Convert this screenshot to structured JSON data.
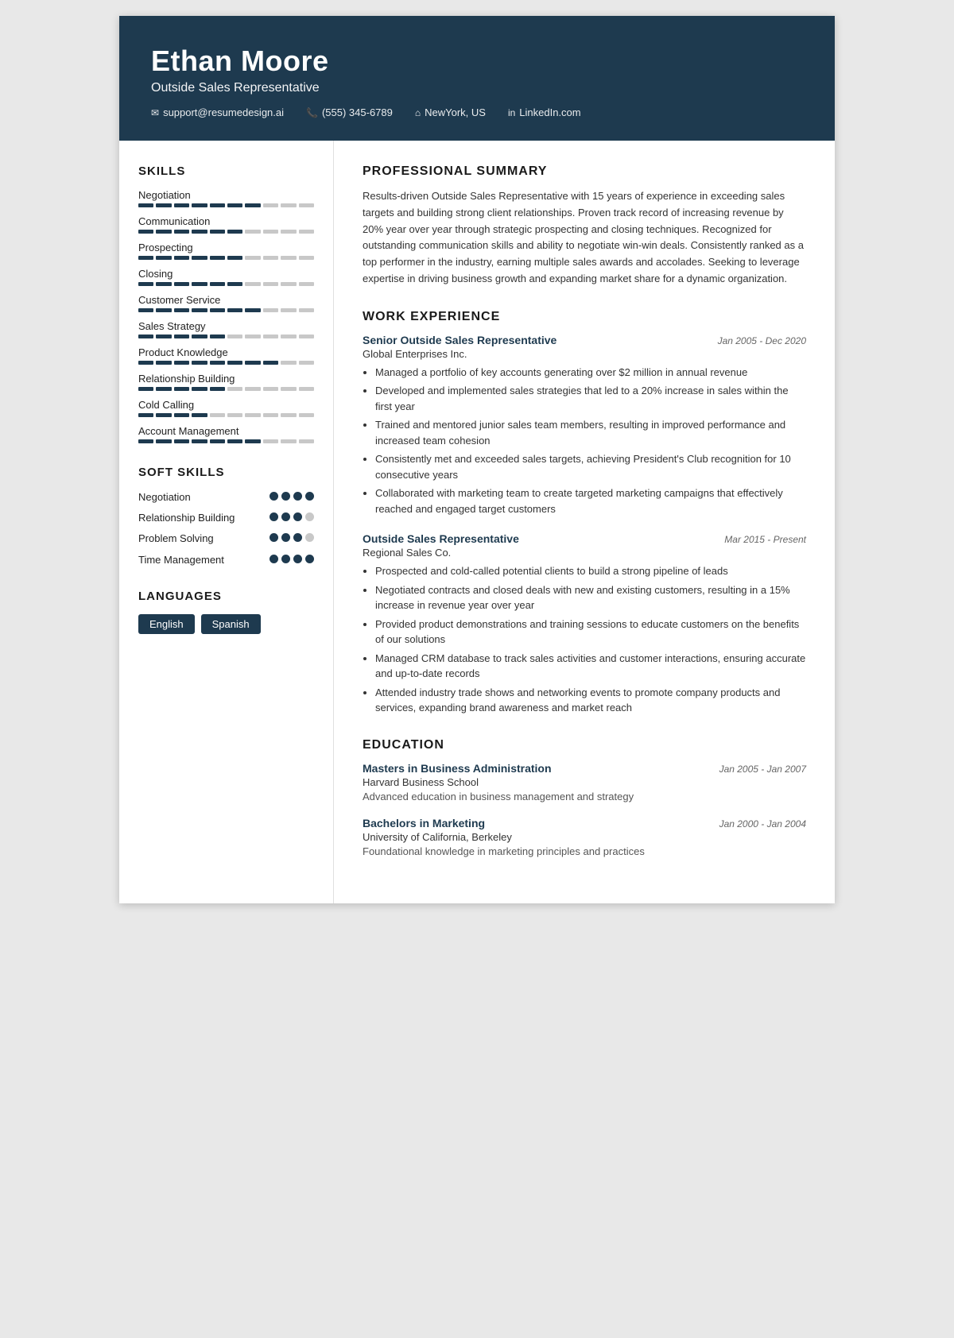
{
  "header": {
    "name": "Ethan Moore",
    "title": "Outside Sales Representative",
    "contact": {
      "email": "support@resumedesign.ai",
      "phone": "(555) 345-6789",
      "location": "NewYork, US",
      "linkedin": "LinkedIn.com"
    }
  },
  "sidebar": {
    "skills_title": "SKILLS",
    "skills": [
      {
        "name": "Negotiation",
        "filled": 7,
        "total": 10
      },
      {
        "name": "Communication",
        "filled": 6,
        "total": 10
      },
      {
        "name": "Prospecting",
        "filled": 6,
        "total": 10
      },
      {
        "name": "Closing",
        "filled": 6,
        "total": 10
      },
      {
        "name": "Customer Service",
        "filled": 7,
        "total": 10
      },
      {
        "name": "Sales Strategy",
        "filled": 5,
        "total": 10
      },
      {
        "name": "Product Knowledge",
        "filled": 8,
        "total": 10
      },
      {
        "name": "Relationship Building",
        "filled": 5,
        "total": 10
      },
      {
        "name": "Cold Calling",
        "filled": 4,
        "total": 10
      },
      {
        "name": "Account Management",
        "filled": 7,
        "total": 10
      }
    ],
    "soft_skills_title": "SOFT SKILLS",
    "soft_skills": [
      {
        "name": "Negotiation",
        "filled": 4,
        "total": 4
      },
      {
        "name": "Relationship Building",
        "filled": 3,
        "total": 4
      },
      {
        "name": "Problem Solving",
        "filled": 3,
        "total": 4
      },
      {
        "name": "Time Management",
        "filled": 4,
        "total": 4
      }
    ],
    "languages_title": "LANGUAGES",
    "languages": [
      "English",
      "Spanish"
    ]
  },
  "main": {
    "summary_title": "PROFESSIONAL SUMMARY",
    "summary": "Results-driven Outside Sales Representative with 15 years of experience in exceeding sales targets and building strong client relationships. Proven track record of increasing revenue by 20% year over year through strategic prospecting and closing techniques. Recognized for outstanding communication skills and ability to negotiate win-win deals. Consistently ranked as a top performer in the industry, earning multiple sales awards and accolades. Seeking to leverage expertise in driving business growth and expanding market share for a dynamic organization.",
    "work_title": "WORK EXPERIENCE",
    "jobs": [
      {
        "title": "Senior Outside Sales Representative",
        "dates": "Jan 2005 - Dec 2020",
        "company": "Global Enterprises Inc.",
        "bullets": [
          "Managed a portfolio of key accounts generating over $2 million in annual revenue",
          "Developed and implemented sales strategies that led to a 20% increase in sales within the first year",
          "Trained and mentored junior sales team members, resulting in improved performance and increased team cohesion",
          "Consistently met and exceeded sales targets, achieving President's Club recognition for 10 consecutive years",
          "Collaborated with marketing team to create targeted marketing campaigns that effectively reached and engaged target customers"
        ]
      },
      {
        "title": "Outside Sales Representative",
        "dates": "Mar 2015 - Present",
        "company": "Regional Sales Co.",
        "bullets": [
          "Prospected and cold-called potential clients to build a strong pipeline of leads",
          "Negotiated contracts and closed deals with new and existing customers, resulting in a 15% increase in revenue year over year",
          "Provided product demonstrations and training sessions to educate customers on the benefits of our solutions",
          "Managed CRM database to track sales activities and customer interactions, ensuring accurate and up-to-date records",
          "Attended industry trade shows and networking events to promote company products and services, expanding brand awareness and market reach"
        ]
      }
    ],
    "education_title": "EDUCATION",
    "education": [
      {
        "degree": "Masters in Business Administration",
        "dates": "Jan 2005 - Jan 2007",
        "school": "Harvard Business School",
        "desc": "Advanced education in business management and strategy"
      },
      {
        "degree": "Bachelors in Marketing",
        "dates": "Jan 2000 - Jan 2004",
        "school": "University of California, Berkeley",
        "desc": "Foundational knowledge in marketing principles and practices"
      }
    ]
  }
}
